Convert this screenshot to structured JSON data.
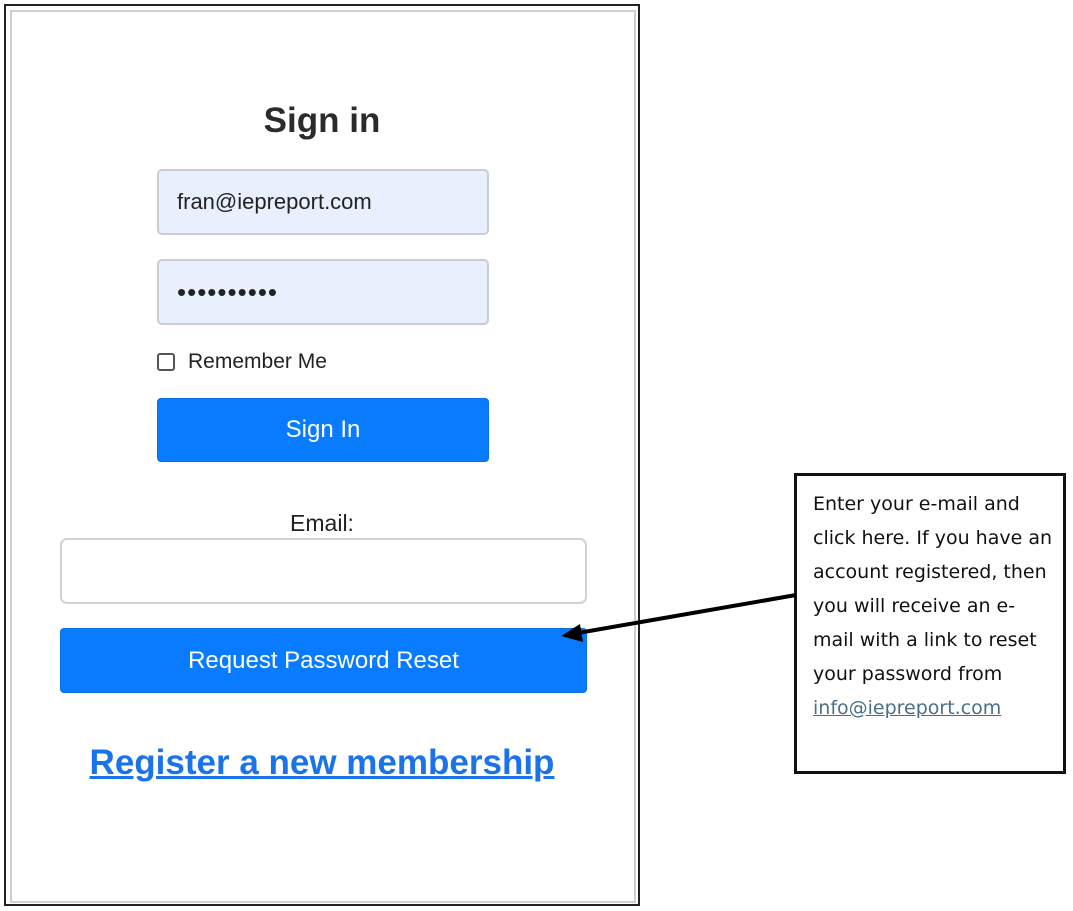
{
  "signin": {
    "title": "Sign in",
    "email_value": "fran@iepreport.com",
    "password_value": "••••••••••",
    "remember_label": "Remember Me",
    "signin_button": "Sign In"
  },
  "reset": {
    "email_label": "Email:",
    "email_value": "",
    "button_label": "Request Password Reset"
  },
  "register": {
    "link_label": "Register a new membership"
  },
  "callout": {
    "text": "Enter your e-mail and click here. If you have an account registered, then you will receive an e-mail with a link to reset your password from",
    "link": "info@iepreport.com"
  },
  "colors": {
    "primary_button": "#087bfe",
    "link": "#1a73e8",
    "autofill_background": "#e8f0fe"
  }
}
